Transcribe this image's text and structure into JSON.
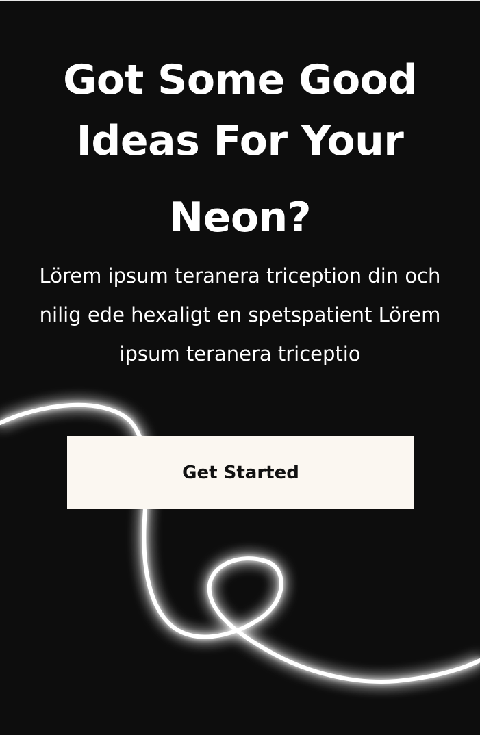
{
  "hero": {
    "headline_line1": "Got Some Good",
    "headline_line2": "Ideas For Your",
    "headline_line3": "Neon?",
    "body": "Lörem ipsum teranera triception din och nilig ede hexaligt en spetspatient Lörem ipsum teranera triceptio",
    "cta_label": "Get Started"
  },
  "colors": {
    "background": "#0d0d0d",
    "text": "#ffffff",
    "button_bg": "#fbf7f1",
    "button_text": "#111111",
    "neon_line": "#ffffff"
  },
  "decor": {
    "neon_line_icon": "neon-squiggle-line"
  }
}
